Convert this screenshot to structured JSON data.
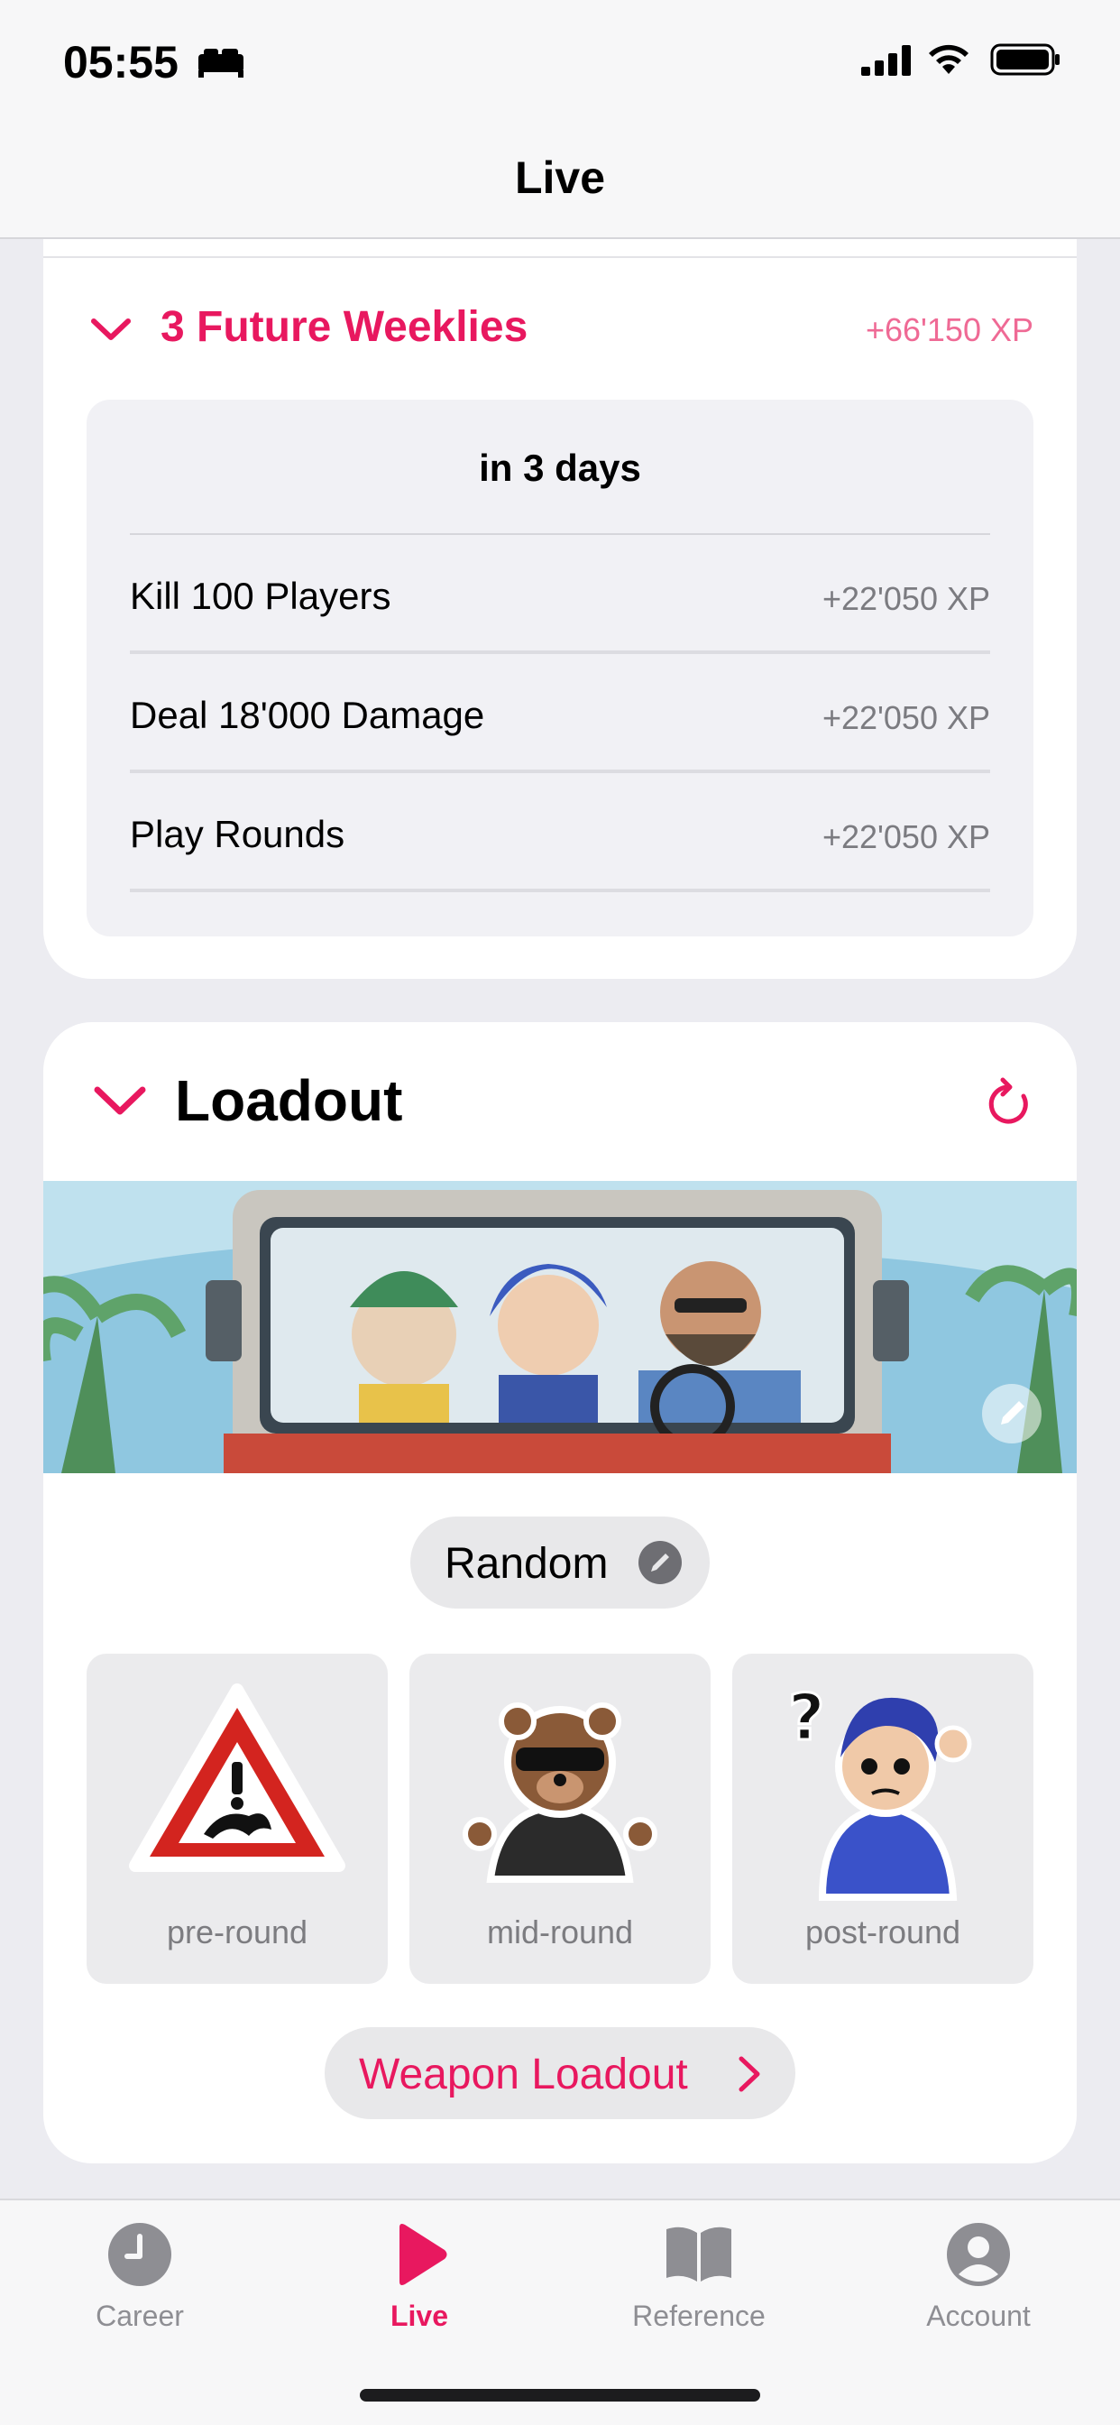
{
  "status_bar": {
    "time": "05:55"
  },
  "nav": {
    "title": "Live"
  },
  "weeklies": {
    "title": "3 Future Weeklies",
    "total_xp": "+66'150 XP",
    "when": "in 3 days",
    "missions": [
      {
        "name": "Kill 100 Players",
        "xp": "+22'050 XP"
      },
      {
        "name": "Deal 18'000 Damage",
        "xp": "+22'050 XP"
      },
      {
        "name": "Play Rounds",
        "xp": "+22'050 XP"
      }
    ]
  },
  "loadout": {
    "title": "Loadout",
    "random_label": "Random",
    "sprays": [
      {
        "label": "pre-round"
      },
      {
        "label": "mid-round"
      },
      {
        "label": "post-round"
      }
    ],
    "weapon_button": "Weapon Loadout"
  },
  "tabs": [
    {
      "label": "Career",
      "icon": "clock-icon"
    },
    {
      "label": "Live",
      "icon": "play-icon",
      "active": true
    },
    {
      "label": "Reference",
      "icon": "book-icon"
    },
    {
      "label": "Account",
      "icon": "person-icon"
    }
  ],
  "colors": {
    "accent": "#e8185f",
    "background": "#ececf1"
  }
}
